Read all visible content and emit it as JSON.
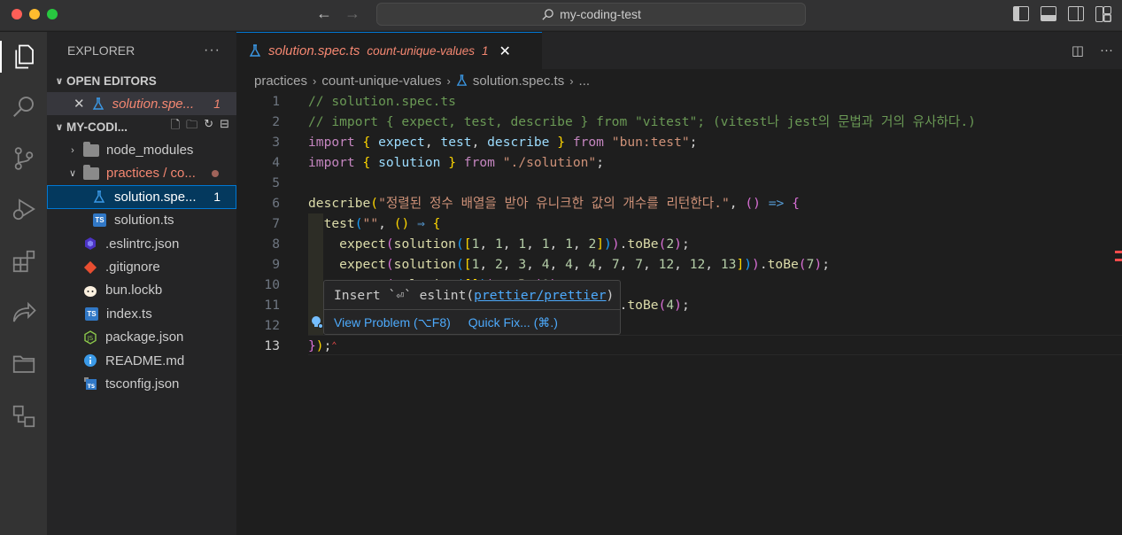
{
  "window": {
    "search_text": "my-coding-test"
  },
  "sidebar": {
    "title": "EXPLORER",
    "more": "···",
    "open_editors_label": "OPEN EDITORS",
    "open_editor": {
      "name": "solution.spe...",
      "count": "1"
    },
    "workspace_label": "MY-CODI...",
    "tree": [
      {
        "name": "node_modules",
        "kind": "folder"
      },
      {
        "name": "practices / co...",
        "kind": "folder-open"
      },
      {
        "name": "solution.spe...",
        "kind": "test-file",
        "count": "1"
      },
      {
        "name": "solution.ts",
        "kind": "ts-file"
      },
      {
        "name": ".eslintrc.json",
        "kind": "eslint-file"
      },
      {
        "name": ".gitignore",
        "kind": "git-file"
      },
      {
        "name": "bun.lockb",
        "kind": "bun-file"
      },
      {
        "name": "index.ts",
        "kind": "ts-file"
      },
      {
        "name": "package.json",
        "kind": "json-file"
      },
      {
        "name": "README.md",
        "kind": "info-file"
      },
      {
        "name": "tsconfig.json",
        "kind": "tsconfig-file"
      }
    ]
  },
  "tab": {
    "name": "solution.spec.ts",
    "description": "count-unique-values",
    "problems": "1",
    "close": "✕"
  },
  "breadcrumb": [
    "practices",
    "count-unique-values",
    "solution.spec.ts",
    "..."
  ],
  "editor": {
    "line_numbers": [
      "1",
      "2",
      "3",
      "4",
      "5",
      "6",
      "7",
      "8",
      "9",
      "10",
      "11",
      "12",
      "13"
    ],
    "current_line": "13"
  },
  "popup": {
    "insert_text": "Insert `⏎` eslint(",
    "rule_link": "prettier/prettier",
    "insert_close": ")",
    "view_problem": "View Problem (⌥F8)",
    "quick_fix": "Quick Fix... (⌘.)"
  },
  "colors": {
    "accent": "#0078d4",
    "error_text": "#f48771",
    "link": "#4daafc"
  }
}
